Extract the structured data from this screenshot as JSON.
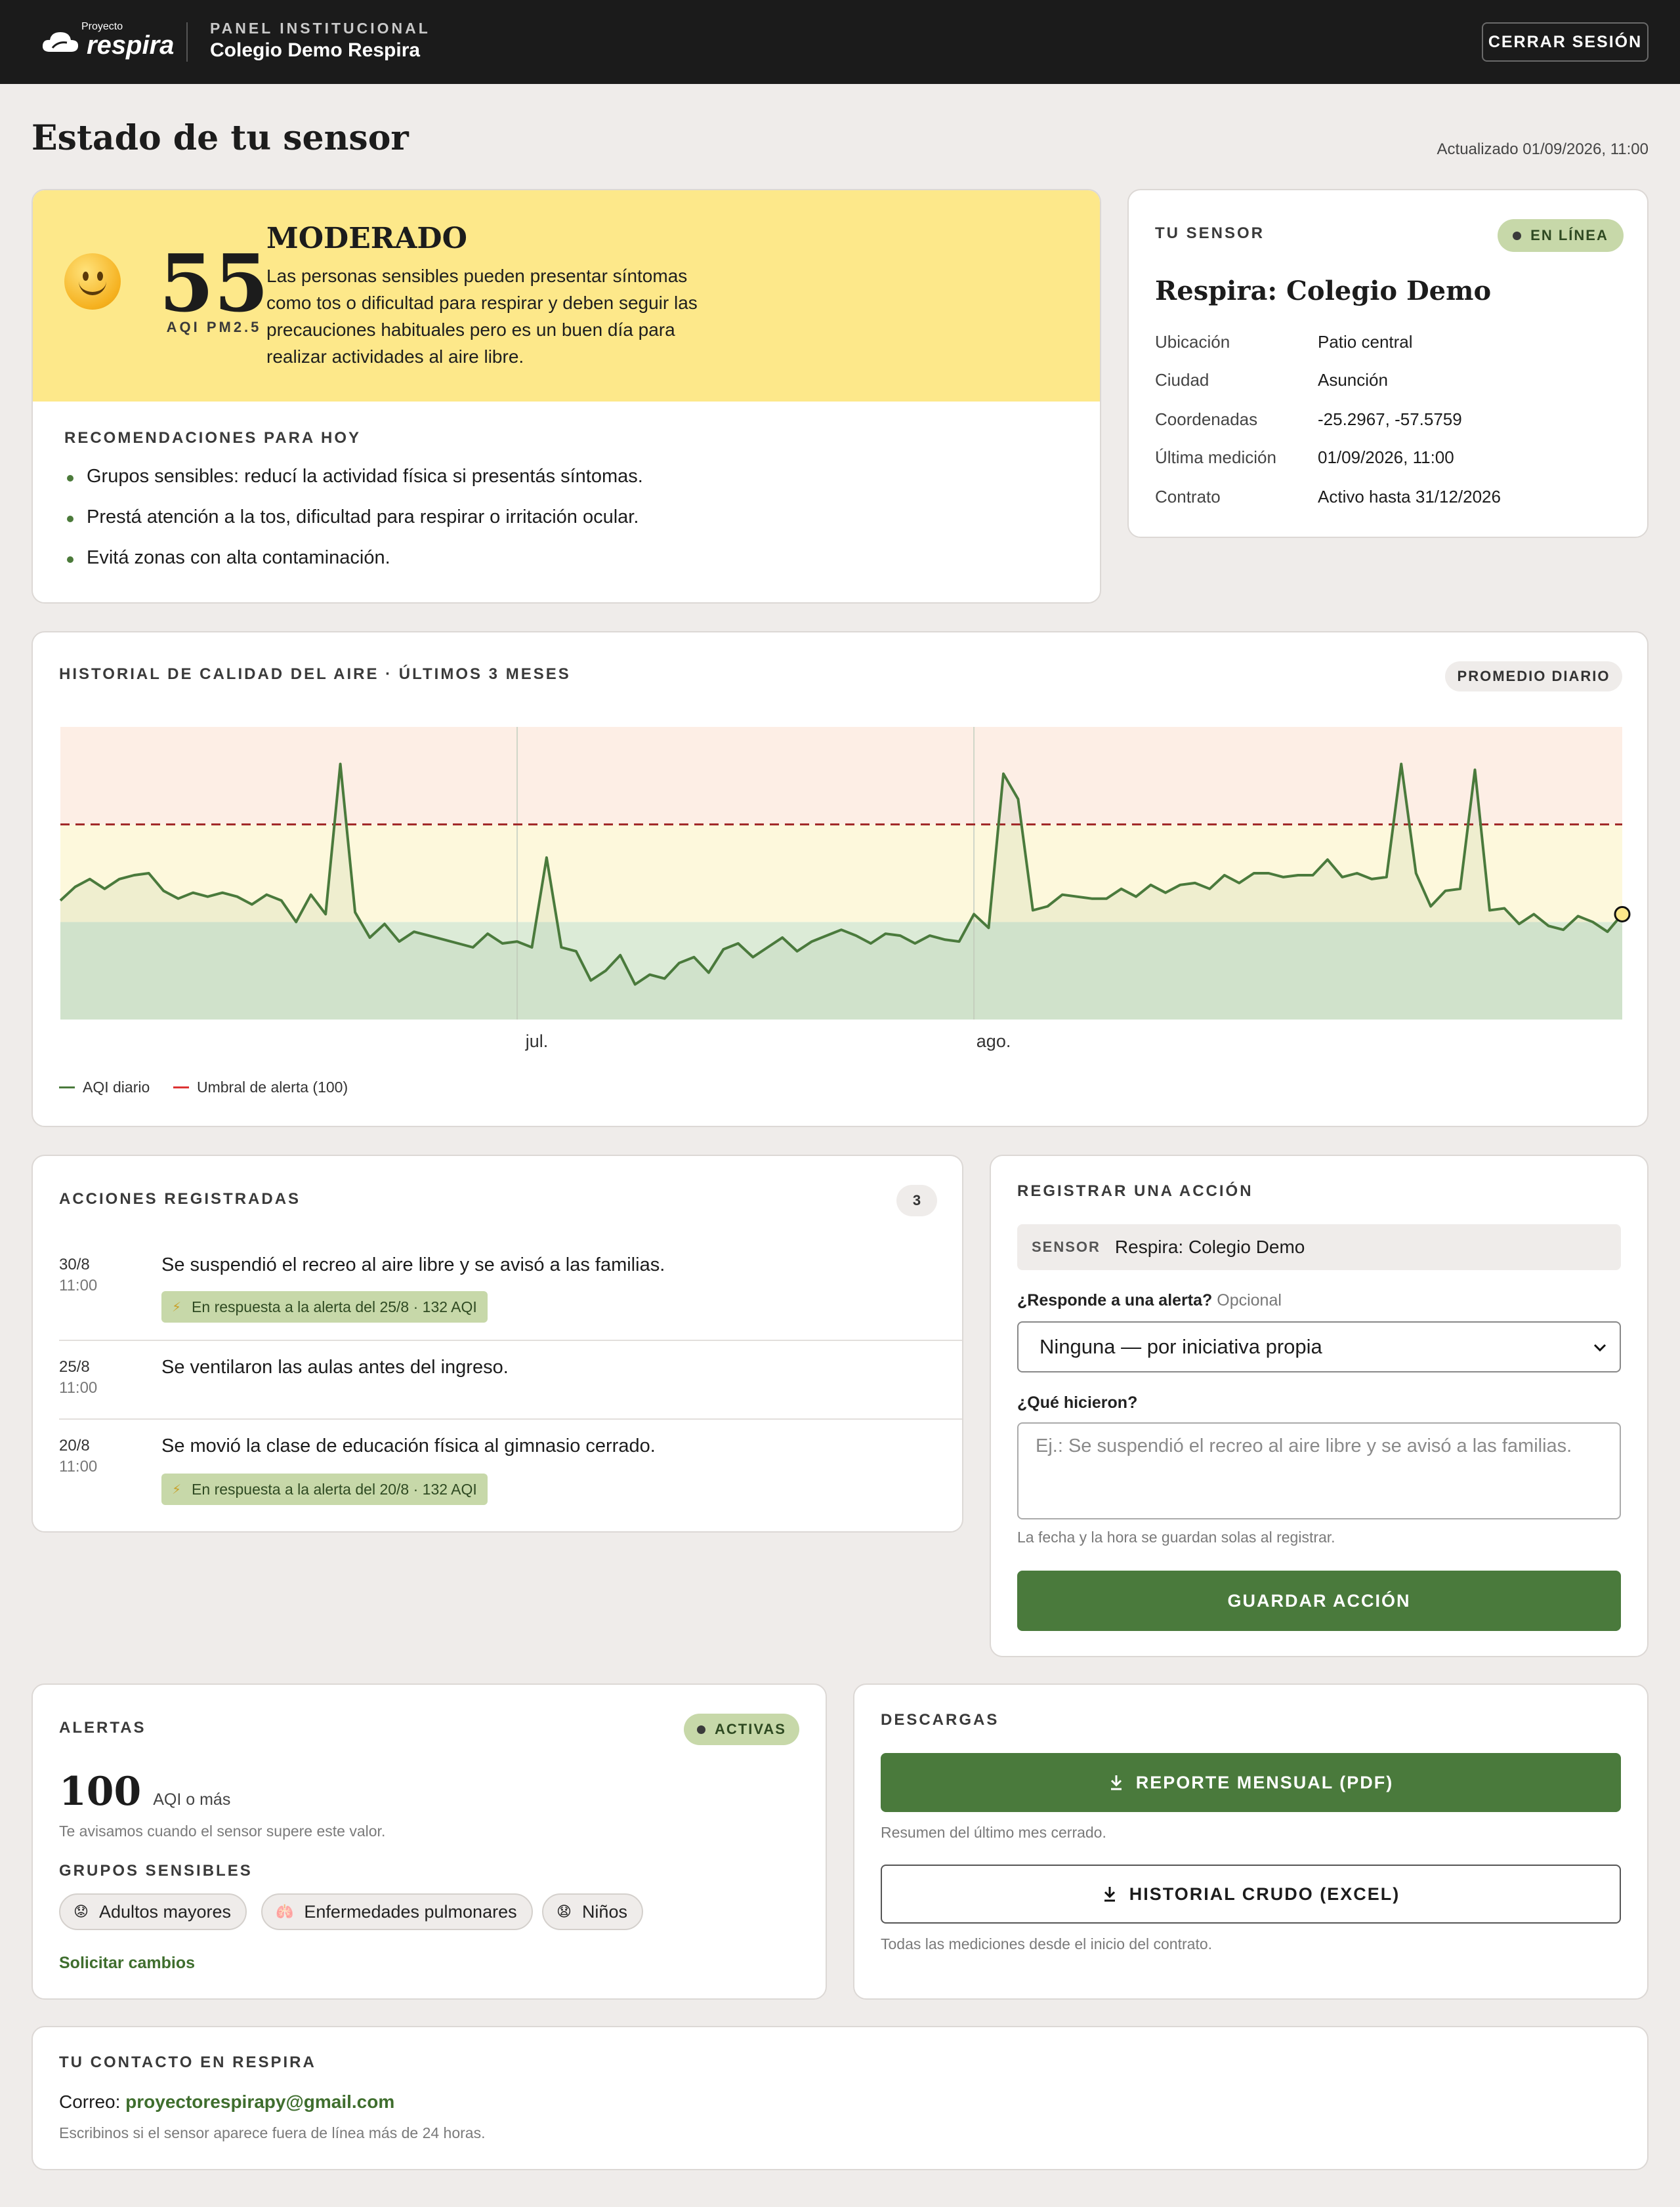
{
  "topbar": {
    "logo_small": "Proyecto",
    "logo_big": "respira",
    "panel_kicker": "PANEL INSTITUCIONAL",
    "school": "Colegio Demo Respira",
    "logout_label": "CERRAR SESIÓN"
  },
  "page": {
    "title": "Estado de tu sensor",
    "updated": "Actualizado 01/09/2026, 11:00"
  },
  "aqi": {
    "value": "55",
    "label": "AQI PM2.5",
    "category": "MODERADO",
    "description": "Las personas sensibles pueden presentar síntomas como tos o dificultad para respirar y deben seguir las precauciones habituales pero es un buen día para realizar actividades al aire libre.",
    "color": "#fde88a",
    "icon": "slightly-smiling-face-icon"
  },
  "recommendations": {
    "title": "RECOMENDACIONES PARA HOY",
    "items": [
      "Grupos sensibles: reducí la actividad física si presentás síntomas.",
      "Prestá atención a la tos, dificultad para respirar o irritación ocular.",
      "Evitá zonas con alta contaminación."
    ]
  },
  "sensor": {
    "kicker": "TU SENSOR",
    "status": "EN LÍNEA",
    "name": "Respira: Colegio Demo",
    "rows": [
      {
        "label": "Ubicación",
        "value": "Patio central"
      },
      {
        "label": "Ciudad",
        "value": "Asunción"
      },
      {
        "label": "Coordenadas",
        "value": "-25.2967, -57.5759"
      },
      {
        "label": "Última medición",
        "value": "01/09/2026, 11:00"
      },
      {
        "label": "Contrato",
        "value": "Activo hasta 31/12/2026"
      }
    ]
  },
  "history": {
    "title": "HISTORIAL DE CALIDAD DEL AIRE · ÚLTIMOS 3 MESES",
    "badge": "PROMEDIO DIARIO",
    "legend_aqi": "AQI diario",
    "legend_threshold": "Umbral de alerta (100)"
  },
  "chart_data": {
    "type": "line",
    "x_ticks": [
      "jul.",
      "ago."
    ],
    "x_tick_index": [
      31,
      62
    ],
    "ylim": [
      0,
      150
    ],
    "bands": [
      {
        "from": 0,
        "to": 50,
        "color": "#dcebd7"
      },
      {
        "from": 50,
        "to": 100,
        "color": "#fdf8dc"
      },
      {
        "from": 100,
        "to": 150,
        "color": "#fdeee5"
      }
    ],
    "threshold": 100,
    "series": [
      {
        "name": "AQI diario",
        "color": "#4a7a3c",
        "values": [
          61,
          68,
          72,
          67,
          72,
          74,
          75,
          66,
          62,
          65,
          63,
          65,
          63,
          59,
          64,
          61,
          50,
          64,
          54,
          131,
          55,
          42,
          49,
          40,
          45,
          43,
          41,
          39,
          37,
          44,
          39,
          40,
          37,
          83,
          37,
          35,
          20,
          25,
          33,
          18,
          23,
          21,
          29,
          32,
          24,
          36,
          39,
          32,
          37,
          42,
          35,
          40,
          43,
          46,
          43,
          39,
          44,
          43,
          39,
          43,
          41,
          40,
          54,
          47,
          126,
          113,
          56,
          58,
          64,
          63,
          62,
          62,
          67,
          63,
          69,
          65,
          69,
          70,
          67,
          74,
          70,
          75,
          75,
          73,
          74,
          74,
          82,
          73,
          75,
          72,
          73,
          131,
          75,
          58,
          66,
          67,
          128,
          56,
          57,
          49,
          54,
          48,
          46,
          53,
          50,
          45,
          54
        ]
      }
    ]
  },
  "actions": {
    "title": "ACCIONES REGISTRADAS",
    "count": "3",
    "items": [
      {
        "date": "30/8",
        "time": "11:00",
        "text": "Se suspendió el recreo al aire libre y se avisó a las familias.",
        "tag": "En respuesta a la alerta del 25/8 · 132 AQI"
      },
      {
        "date": "25/8",
        "time": "11:00",
        "text": "Se ventilaron las aulas antes del ingreso.",
        "tag": ""
      },
      {
        "date": "20/8",
        "time": "11:00",
        "text": "Se movió la clase de educación física al gimnasio cerrado.",
        "tag": "En respuesta a la alerta del 20/8 · 132 AQI"
      }
    ]
  },
  "register": {
    "title": "REGISTRAR UNA ACCIÓN",
    "sensor_label": "SENSOR",
    "sensor_value": "Respira: Colegio Demo",
    "alert_label": "¿Responde a una alerta?",
    "alert_optional": "Opcional",
    "alert_value": "Ninguna — por iniciativa propia",
    "what_label": "¿Qué hicieron?",
    "what_placeholder": "Ej.: Se suspendió el recreo al aire libre y se avisó a las familias.",
    "note": "La fecha y la hora se guardan solas al registrar.",
    "save_label": "GUARDAR ACCIÓN"
  },
  "alerts": {
    "title": "ALERTAS",
    "status": "ACTIVAS",
    "threshold": "100",
    "threshold_unit": "AQI o más",
    "threshold_note": "Te avisamos cuando el sensor supere este valor.",
    "groups_title": "GRUPOS SENSIBLES",
    "groups": [
      {
        "label": "Adultos mayores",
        "icon": "elderly-face-icon"
      },
      {
        "label": "Enfermedades pulmonares",
        "icon": "lungs-icon"
      },
      {
        "label": "Niños",
        "icon": "child-face-icon"
      }
    ],
    "request_link": "Solicitar cambios"
  },
  "downloads": {
    "title": "DESCARGAS",
    "monthly_label": "REPORTE MENSUAL (PDF)",
    "monthly_note": "Resumen del último mes cerrado.",
    "raw_label": "HISTORIAL CRUDO (EXCEL)",
    "raw_note": "Todas las mediciones desde el inicio del contrato."
  },
  "contact": {
    "title": "TU CONTACTO EN RESPIRA",
    "email_prefix": "Correo:",
    "email": "proyectorespirapy@gmail.com",
    "note": "Escribinos si el sensor aparece fuera de línea más de 24 horas."
  }
}
